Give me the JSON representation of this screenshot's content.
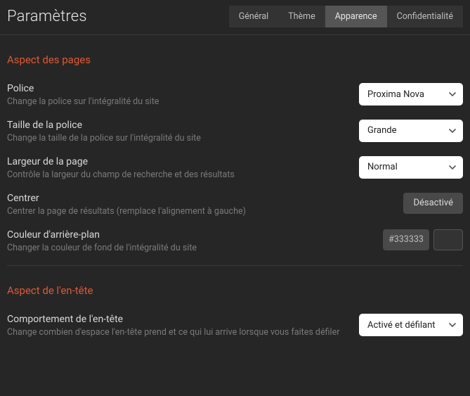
{
  "header": {
    "title": "Paramètres",
    "tabs": [
      {
        "label": "Général"
      },
      {
        "label": "Thème"
      },
      {
        "label": "Apparence"
      },
      {
        "label": "Confidentialité"
      }
    ]
  },
  "sections": {
    "page_look": {
      "title": "Aspect des pages",
      "font": {
        "label": "Police",
        "desc": "Change la police sur l'intégralité du site",
        "value": "Proxima Nova"
      },
      "font_size": {
        "label": "Taille de la police",
        "desc": "Change la taille de la police sur l'intégralité du site",
        "value": "Grande"
      },
      "page_width": {
        "label": "Largeur de la page",
        "desc": "Contrôle la largeur du champ de recherche et des résultats",
        "value": "Normal"
      },
      "center": {
        "label": "Centrer",
        "desc": "Centrer la page de résultats (remplace l'alignement à gauche)",
        "value": "Désactivé"
      },
      "bg_color": {
        "label": "Couleur d'arrière-plan",
        "desc": "Changer la couleur de fond de l'intégralité du site",
        "value": "#333333"
      }
    },
    "header_look": {
      "title": "Aspect de l'en-tête",
      "behavior": {
        "label": "Comportement de l'en-tête",
        "desc": "Change combien d'espace l'en-tête prend et ce qui lui arrive lorsque vous faites défiler",
        "value": "Activé et défilant"
      }
    }
  }
}
